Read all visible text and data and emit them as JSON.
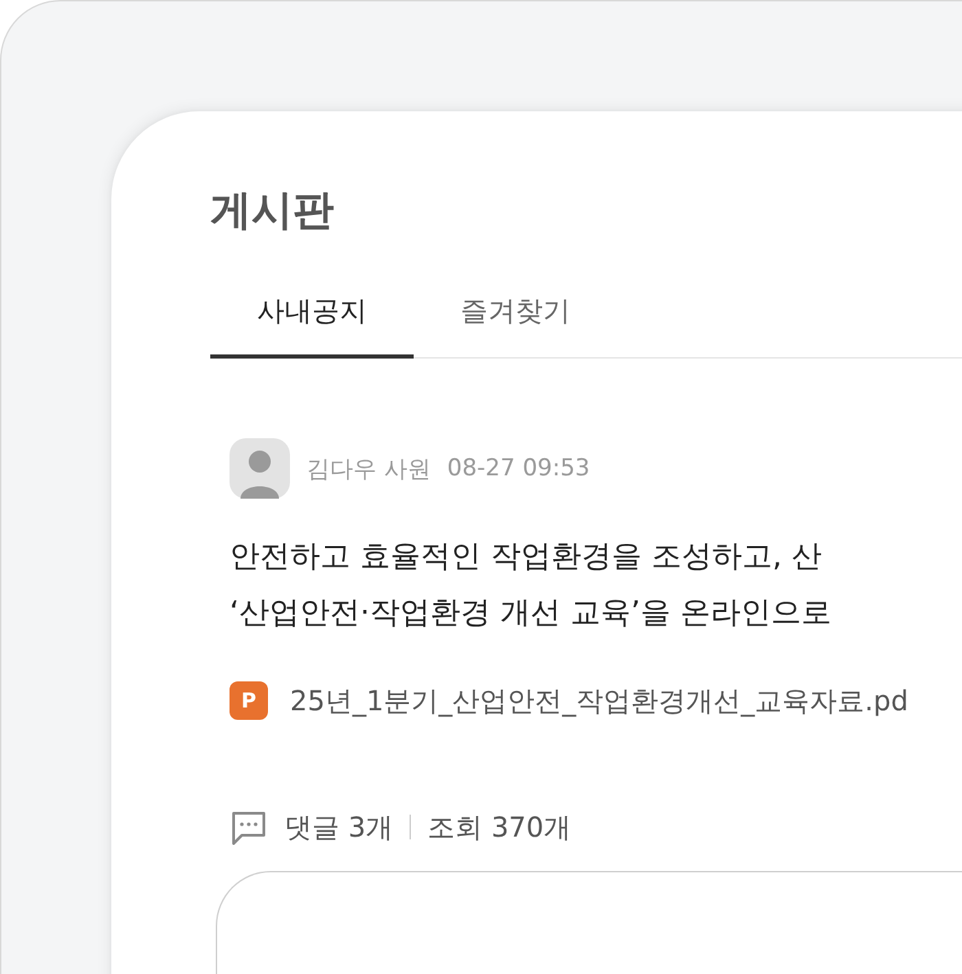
{
  "page": {
    "title": "게시판"
  },
  "tabs": [
    {
      "label": "사내공지",
      "selected": true
    },
    {
      "label": "즐겨찾기",
      "selected": false
    }
  ],
  "post": {
    "author": "김다우 사원",
    "time": "08-27 09:53",
    "body_lines": [
      "안전하고 효율적인 작업환경을 조성하고, 산",
      "‘산업안전·작업환경 개선 교육’을 온라인으로"
    ],
    "attachment": {
      "badge": "P",
      "name": "25년_1분기_산업안전_작업환경개선_교육자료.pd"
    },
    "comments": "댓글 3개",
    "views": "조회 370개"
  }
}
